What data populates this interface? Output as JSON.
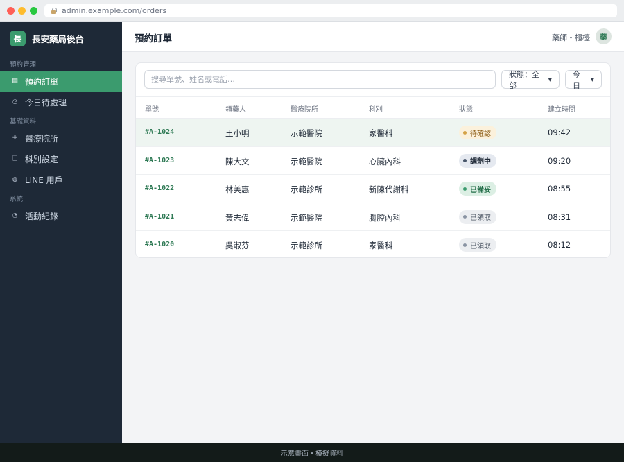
{
  "browser": {
    "url": "admin.example.com/orders"
  },
  "brand": {
    "logo_char": "長",
    "name": "長安藥局後台"
  },
  "sidebar": {
    "sections": [
      {
        "label": "預約管理",
        "items": [
          {
            "label": "預約訂單",
            "icon": "list-icon",
            "glyph": "▤",
            "active": true
          },
          {
            "label": "今日待處理",
            "icon": "clock-icon",
            "glyph": "◷",
            "active": false
          }
        ]
      },
      {
        "label": "基礎資料",
        "items": [
          {
            "label": "醫療院所",
            "icon": "plus-icon",
            "glyph": "✚",
            "active": false
          },
          {
            "label": "科別設定",
            "icon": "copy-icon",
            "glyph": "❏",
            "active": false
          },
          {
            "label": "LINE 用戶",
            "icon": "user-icon",
            "glyph": "◍",
            "active": false
          }
        ]
      },
      {
        "label": "系統",
        "items": [
          {
            "label": "活動紀錄",
            "icon": "activity-icon",
            "glyph": "◔",
            "active": false
          }
        ]
      }
    ]
  },
  "header": {
    "title": "預約訂單",
    "user_label": "藥師・櫃檯",
    "avatar_char": "藥"
  },
  "toolbar": {
    "search_placeholder": "搜尋單號、姓名或電話…",
    "status_filter": "狀態：全部",
    "date_filter": "今日"
  },
  "table": {
    "columns": [
      "單號",
      "領藥人",
      "醫療院所",
      "科別",
      "狀態",
      "建立時間"
    ],
    "rows": [
      {
        "id": "#A-1024",
        "name": "王小明",
        "clinic": "示範醫院",
        "dept": "家醫科",
        "status": "待確認",
        "status_kind": "pending",
        "time": "09:42"
      },
      {
        "id": "#A-1023",
        "name": "陳大文",
        "clinic": "示範醫院",
        "dept": "心臟內科",
        "status": "調劑中",
        "status_kind": "prep",
        "time": "09:20"
      },
      {
        "id": "#A-1022",
        "name": "林美惠",
        "clinic": "示範診所",
        "dept": "新陳代謝科",
        "status": "已備妥",
        "status_kind": "ready",
        "time": "08:55"
      },
      {
        "id": "#A-1021",
        "name": "黃志偉",
        "clinic": "示範醫院",
        "dept": "胸腔內科",
        "status": "已領取",
        "status_kind": "done",
        "time": "08:31"
      },
      {
        "id": "#A-1020",
        "name": "吳淑芬",
        "clinic": "示範診所",
        "dept": "家醫科",
        "status": "已領取",
        "status_kind": "done",
        "time": "08:12"
      }
    ]
  },
  "footer": {
    "text": "示意畫面・模擬資料"
  },
  "colors": {
    "accent": "#3b9b6e",
    "sidebar_bg": "#1e2937",
    "footer_bg": "#131b19"
  }
}
